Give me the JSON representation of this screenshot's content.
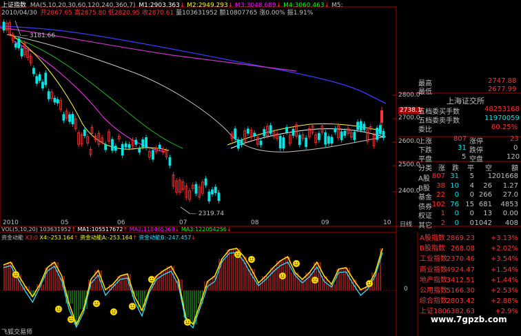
{
  "header": {
    "title": "上证指数",
    "ma_label": "MA(5,10,20,30,60,120,240,360,7)",
    "ma1": "M1:2903.363",
    "ma2": "M2:2949.293",
    "ma3": "M3:3048.689",
    "ma4": "M4:3060.463",
    "ma5": "M5:",
    "date": "2010/04/30",
    "open": "开2867.65",
    "high": "高2875.80",
    "low": "低2820.95",
    "close": "收2870.61",
    "volume": "量103631952",
    "amount": "额10807765",
    "change": "涨0.00%",
    "amplitude": "振1.91%"
  },
  "main_chart": {
    "high_marker": "3181.66",
    "low_marker": "2319.74",
    "price_ticks": [
      "2800.0",
      "2700.0",
      "2600.0",
      "2500.0",
      "2400.0"
    ],
    "current_price": "2738.1",
    "x_ticks": [
      "2010",
      "05",
      "06",
      "07",
      "08",
      "09",
      "10"
    ],
    "period": "日线"
  },
  "volume_bar": {
    "label": "VOL(5,10,20)",
    "value": "103631952",
    "ma1": "MA1:105517672",
    "ma2": "MA2:118465368",
    "ma3": "MA3:122054256"
  },
  "indicator": {
    "name": "资金动能",
    "x3": "X3:0",
    "x4": "X4:-253.164",
    "a": "资金动能A:-253.164",
    "b": "资金动能B:-247.457",
    "zero": "0",
    "app_name": "飞狐交易师"
  },
  "quote": {
    "high_label": "最高",
    "high_value": "2747.88",
    "low_label": "最低",
    "low_value": "2677.99",
    "exchange": "上海证交所",
    "buy_label": "五档委买手数",
    "buy_value": "48253168",
    "sell_label": "五档委卖手数",
    "sell_value": "11970059",
    "ratio_label": "委比",
    "ratio_value": "60.25%",
    "up_label": "上涨",
    "up_value": "807",
    "limit_up_label": "涨停",
    "limit_up_value": "23",
    "down_label": "下跌",
    "down_value": "31",
    "limit_down_label": "跌停",
    "limit_down_value": "0",
    "flat_label": "平盘",
    "flat_value": "5",
    "empty_label": "空盘",
    "empty_value": "120"
  },
  "breadth": {
    "headers": [
      "分类",
      "涨",
      "跌",
      "平",
      "空",
      "額"
    ],
    "rows": [
      {
        "name": "A股",
        "up": "807",
        "down": "31",
        "flat": "5",
        "empty": "1",
        "amount": "201668"
      },
      {
        "name": "B股",
        "up": "38",
        "down": "10",
        "flat": "4",
        "empty": "26",
        "amount": "1.27"
      },
      {
        "name": "基金",
        "up": "22",
        "down": "0",
        "flat": "0",
        "empty": "266",
        "amount": "27.0"
      },
      {
        "name": "债券",
        "up": "102",
        "down": "76",
        "flat": "15",
        "empty": "681",
        "amount": "4853"
      },
      {
        "name": "权证",
        "up": "1",
        "down": "0",
        "flat": "0",
        "empty": "13",
        "amount": "0.00"
      },
      {
        "name": "其它",
        "up": "2",
        "down": "0",
        "flat": "0",
        "empty": "1042",
        "amount": "408"
      }
    ]
  },
  "indices": [
    {
      "name": "A股指数",
      "value": "2869.23",
      "change": "+3.13%"
    },
    {
      "name": "B股指数",
      "value": "268.08",
      "change": "+2.02%"
    },
    {
      "name": "工业指数",
      "value": "2370.46",
      "change": "+3.54%"
    },
    {
      "name": "商业指数",
      "value": "4924.47",
      "change": "+1.54%"
    },
    {
      "name": "地产指数",
      "value": "3412.51",
      "change": "+1.44%"
    },
    {
      "name": "公用指数",
      "value": "5166.30",
      "change": "+2.53%"
    },
    {
      "name": "综合指数",
      "value": "2803.42",
      "change": "+2.88%"
    },
    {
      "name": "上证180",
      "value": "6382.63",
      "change": "+2.9%"
    }
  ],
  "watermark": "www.7gpzb.com",
  "colors": {
    "up": "#ff3232",
    "down": "#00e5e5",
    "ma1": "#ffffff",
    "ma2": "#ffff00",
    "ma3": "#ff00ff",
    "ma4": "#00ff00",
    "panel_border": "#aa0000"
  }
}
